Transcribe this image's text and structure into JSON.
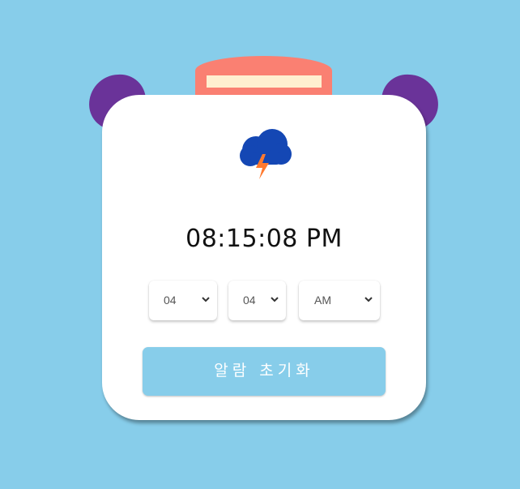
{
  "colors": {
    "background": "#87CDEA",
    "bell": "#6A3399",
    "top_cap": "#FA8072",
    "top_cap_slot": "#FFEFD0",
    "card": "#FFFFFF",
    "cloud": "#1447B4",
    "lightning": "#FF7A2F",
    "button": "#87CDEA"
  },
  "weather": {
    "icon": "thunderstorm-icon"
  },
  "clock": {
    "time": "08:15:08 PM"
  },
  "alarm": {
    "hour": {
      "selected": "04"
    },
    "minute": {
      "selected": "04"
    },
    "ampm": {
      "selected": "AM"
    },
    "reset_label": "알람 초기화"
  }
}
